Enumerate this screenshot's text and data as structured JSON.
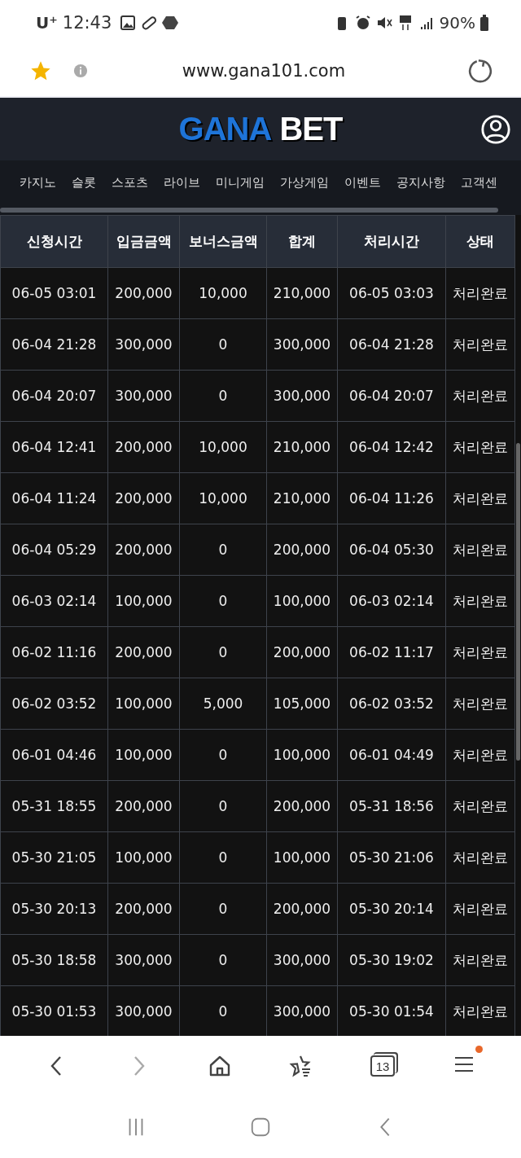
{
  "status_bar": {
    "carrier": "U⁺",
    "time": "12:43",
    "battery": "90%"
  },
  "address_bar": {
    "bookmarked": true,
    "url": "www.gana101.com"
  },
  "site_header": {
    "logo": [
      "GANA",
      "BET"
    ]
  },
  "nav": [
    "카지노",
    "슬롯",
    "스포츠",
    "라이브",
    "미니게임",
    "가상게임",
    "이벤트",
    "공지사항",
    "고객센"
  ],
  "table": {
    "columns": [
      "신청시간",
      "입금금액",
      "보너스금액",
      "합계",
      "처리시간",
      "상태"
    ],
    "rows": [
      [
        "06-05 03:01",
        "200,000",
        "10,000",
        "210,000",
        "06-05 03:03",
        "처리완료"
      ],
      [
        "06-04 21:28",
        "300,000",
        "0",
        "300,000",
        "06-04 21:28",
        "처리완료"
      ],
      [
        "06-04 20:07",
        "300,000",
        "0",
        "300,000",
        "06-04 20:07",
        "처리완료"
      ],
      [
        "06-04 12:41",
        "200,000",
        "10,000",
        "210,000",
        "06-04 12:42",
        "처리완료"
      ],
      [
        "06-04 11:24",
        "200,000",
        "10,000",
        "210,000",
        "06-04 11:26",
        "처리완료"
      ],
      [
        "06-04 05:29",
        "200,000",
        "0",
        "200,000",
        "06-04 05:30",
        "처리완료"
      ],
      [
        "06-03 02:14",
        "100,000",
        "0",
        "100,000",
        "06-03 02:14",
        "처리완료"
      ],
      [
        "06-02 11:16",
        "200,000",
        "0",
        "200,000",
        "06-02 11:17",
        "처리완료"
      ],
      [
        "06-02 03:52",
        "100,000",
        "5,000",
        "105,000",
        "06-02 03:52",
        "처리완료"
      ],
      [
        "06-01 04:46",
        "100,000",
        "0",
        "100,000",
        "06-01 04:49",
        "처리완료"
      ],
      [
        "05-31 18:55",
        "200,000",
        "0",
        "200,000",
        "05-31 18:56",
        "처리완료"
      ],
      [
        "05-30 21:05",
        "100,000",
        "0",
        "100,000",
        "05-30 21:06",
        "처리완료"
      ],
      [
        "05-30 20:13",
        "200,000",
        "0",
        "200,000",
        "05-30 20:14",
        "처리완료"
      ],
      [
        "05-30 18:58",
        "300,000",
        "0",
        "300,000",
        "05-30 19:02",
        "처리완료"
      ],
      [
        "05-30 01:53",
        "300,000",
        "0",
        "300,000",
        "05-30 01:54",
        "처리완료"
      ]
    ]
  },
  "toolbar": {
    "tab_count": "13",
    "menu_badge": true
  }
}
